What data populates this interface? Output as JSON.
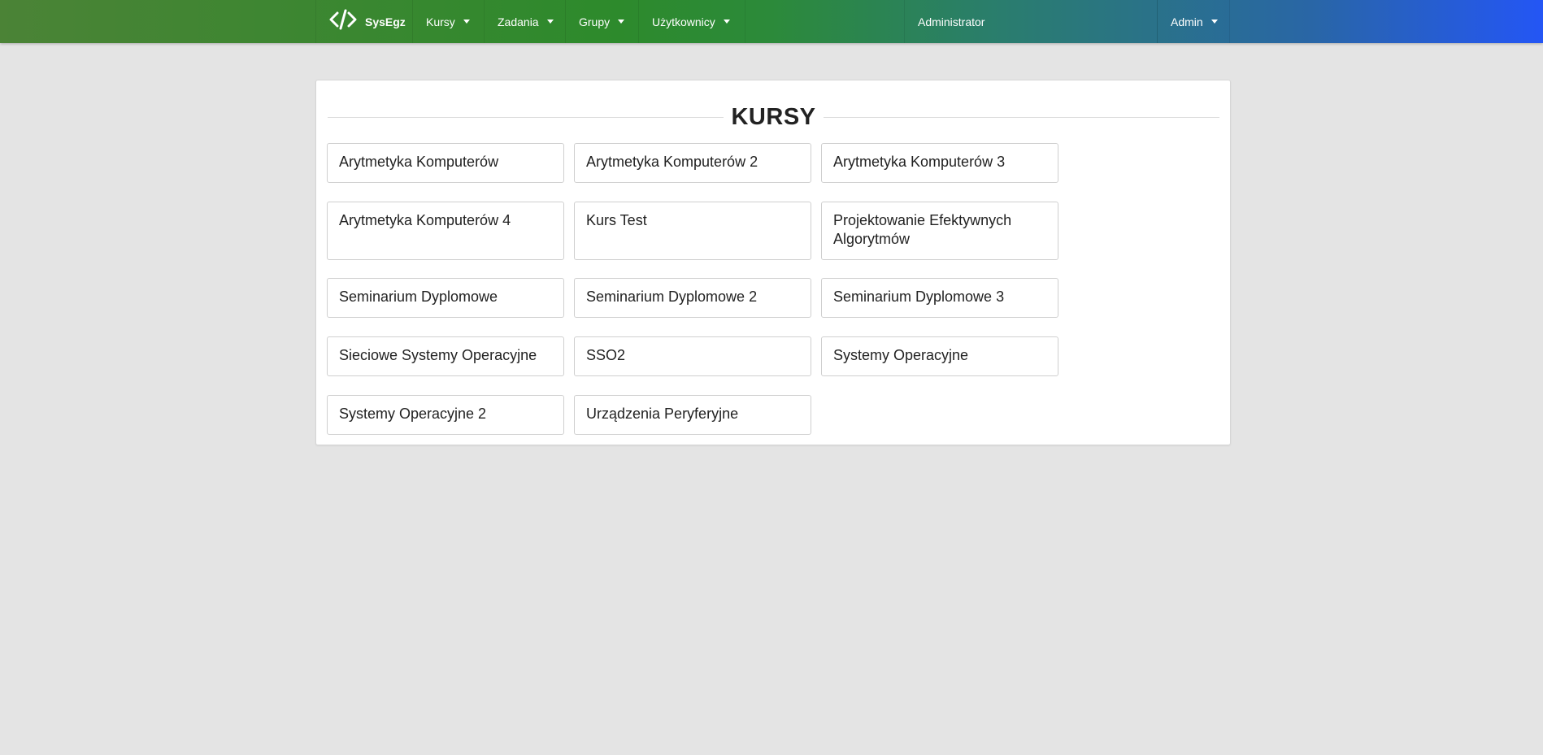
{
  "navbar": {
    "brand": "SysEgz",
    "menus": [
      {
        "label": "Kursy"
      },
      {
        "label": "Zadania"
      },
      {
        "label": "Grupy"
      },
      {
        "label": "Użytkownicy"
      }
    ],
    "role_text": "Administrator",
    "user_menu": "Admin"
  },
  "icons": {
    "brand": "code-icon",
    "dropdown": "caret-down-icon"
  },
  "main": {
    "title": "KURSY",
    "courses": [
      "Arytmetyka Komputerów",
      "Arytmetyka Komputerów 2",
      "Arytmetyka Komputerów 3",
      "Arytmetyka Komputerów 4",
      "Kurs Test",
      "Projektowanie Efektywnych Algorytmów",
      "Seminarium Dyplomowe",
      "Seminarium Dyplomowe 2",
      "Seminarium Dyplomowe 3",
      "Sieciowe Systemy Operacyjne",
      "SSO2",
      "Systemy Operacyjne",
      "Systemy Operacyjne 2",
      "Urządzenia Peryferyjne"
    ]
  },
  "colors": {
    "navbar_start": "#4b8336",
    "navbar_mid": "#2d8a2c",
    "navbar_end": "#2456f5",
    "background": "#e4e4e4"
  }
}
